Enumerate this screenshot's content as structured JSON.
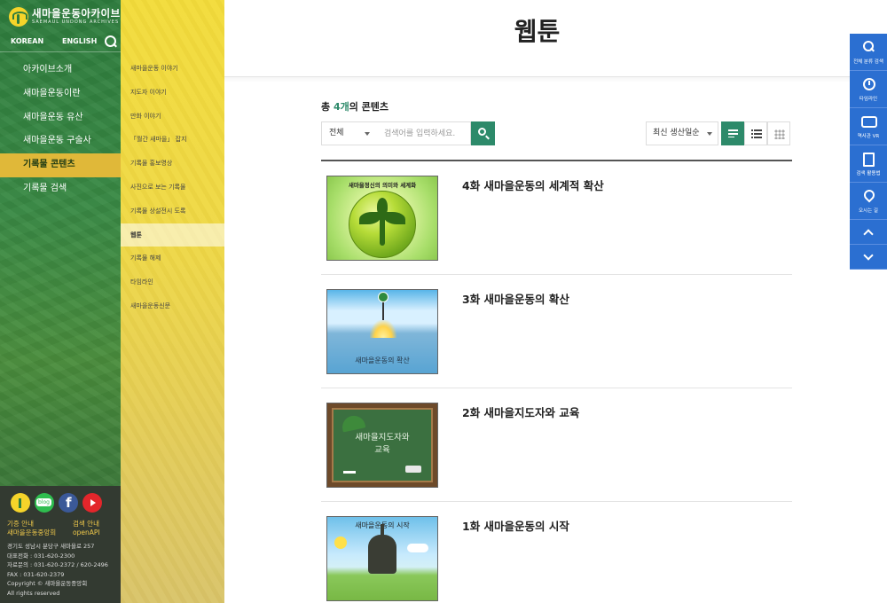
{
  "site": {
    "logo_title": "새마을운동아카이브",
    "logo_sub": "SAEMAUL UNDONG ARCHIVES",
    "lang_korean": "KOREAN",
    "lang_english": "ENGLISH"
  },
  "nav": {
    "main": [
      "아카이브소개",
      "새마을운동이란",
      "새마을운동 유산",
      "새마을운동 구술사",
      "기록물 콘텐츠",
      "기록물 검색"
    ],
    "active_index": 4,
    "sub": [
      "새마을운동 이야기",
      "지도자 이야기",
      "만화 이야기",
      "「월간 새마을」 잡지",
      "기록물 홍보영상",
      "사진으로 보는 기록물",
      "기록물 상설전시 도록",
      "웹툰",
      "기록물 해제",
      "타임라인",
      "새마을운동신문"
    ],
    "sub_active_index": 7
  },
  "footer": {
    "link1": "기증 안내",
    "link2": "새마을운동중앙회",
    "link3": "검색 안내",
    "link4": "openAPI",
    "address": "경기도 성남시 분당구 새마을로 257",
    "phone": "대표전화 : 031-620-2300",
    "inquiry": "자료문의 : 031-620-2372 / 620-2496",
    "fax": "FAX : 031-620-2379",
    "copyright": "Copyright © 새마을운동중앙회",
    "rights": "All rights reserved"
  },
  "page": {
    "title": "웹툰",
    "count_prefix": "총 ",
    "count_num": "4개",
    "count_suffix": "의 콘텐츠",
    "filter_value": "전체",
    "search_placeholder": "검색어를 입력하세요.",
    "sort_value": "최신 생산일순"
  },
  "items": [
    {
      "title": "4화 새마을운동의 세계적 확산",
      "thumb_caption": "새마을정신의 의미와 세계화"
    },
    {
      "title": "3화 새마을운동의 확산",
      "thumb_caption": "새마을운동의 확산"
    },
    {
      "title": "2화 새마을지도자와 교육",
      "thumb_caption": "새마을지도자와",
      "thumb_caption2": "교육"
    },
    {
      "title": "1화 새마을운동의 시작",
      "thumb_caption": "새마을운동의 시작"
    }
  ],
  "quick_menu": {
    "search": "전체 분류 검색",
    "timeline": "타임라인",
    "vr": "역사관 VR",
    "guide": "검색 활용법",
    "directions": "오시는 길"
  },
  "colors": {
    "accent": "#2d8a6a",
    "nav_green": "#2e7d3e",
    "nav_yellow": "#f3dc3b",
    "quick_blue": "#2b6fd1"
  }
}
